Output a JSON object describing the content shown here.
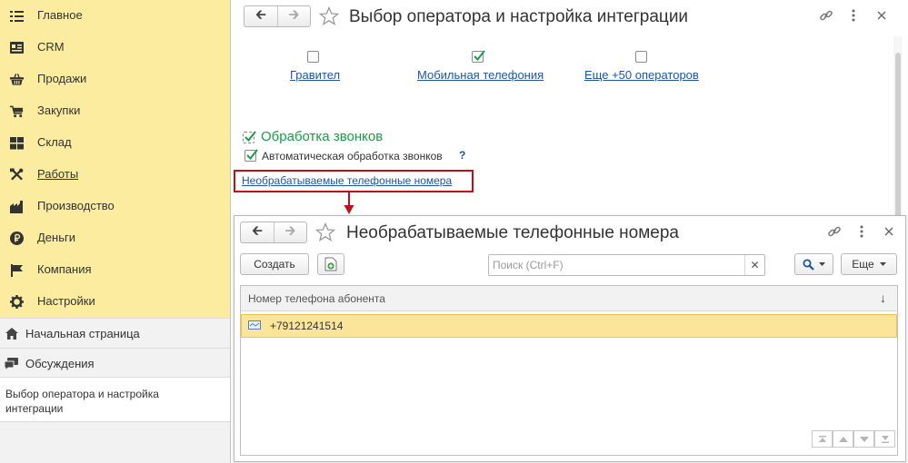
{
  "sidebar": {
    "sections": [
      {
        "label": "Главное",
        "icon": "list-icon"
      },
      {
        "label": "CRM",
        "icon": "contacts-icon"
      },
      {
        "label": "Продажи",
        "icon": "basket-icon"
      },
      {
        "label": "Закупки",
        "icon": "cart-icon"
      },
      {
        "label": "Склад",
        "icon": "warehouse-icon"
      },
      {
        "label": "Работы",
        "icon": "tools-icon"
      },
      {
        "label": "Производство",
        "icon": "factory-icon"
      },
      {
        "label": "Деньги",
        "icon": "ruble-icon"
      },
      {
        "label": "Компания",
        "icon": "flag-icon"
      },
      {
        "label": "Настройки",
        "icon": "gear-icon"
      }
    ],
    "home": "Начальная страница",
    "discussions": "Обсуждения",
    "open_window": "Выбор оператора и настройка интеграции"
  },
  "main": {
    "title": "Выбор оператора и настройка интеграции",
    "operators": [
      {
        "label": "Гравител",
        "checked": false
      },
      {
        "label": "Мобильная телефония",
        "checked": true
      },
      {
        "label": "Еще +50 операторов",
        "checked": false
      }
    ],
    "call_processing_group": "Обработка звонков",
    "auto_processing_label": "Автоматическая обработка звонков",
    "help_mark": "?",
    "unprocessed_link": "Необрабатываемые телефонные номера"
  },
  "sub": {
    "title": "Необрабатываемые телефонные номера",
    "create_button": "Создать",
    "search_placeholder": "Поиск (Ctrl+F)",
    "more_button": "Еще",
    "column_header": "Номер телефона абонента",
    "rows": [
      "+79121241514"
    ]
  },
  "colors": {
    "sections_bg": "#fbeca0",
    "link": "#1d55a6",
    "group_green": "#1a9b46",
    "highlight_red": "#c0101a",
    "row_selected": "#fbe59a"
  }
}
